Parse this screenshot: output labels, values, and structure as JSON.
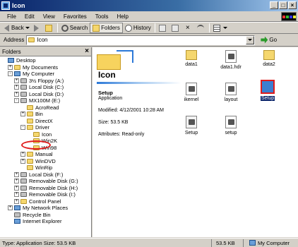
{
  "window": {
    "title": "Icon",
    "buttons": {
      "minimize": "_",
      "maximize": "□",
      "close": "×"
    }
  },
  "menubar": {
    "items": [
      "File",
      "Edit",
      "View",
      "Favorites",
      "Tools",
      "Help"
    ]
  },
  "toolbar": {
    "back_label": "Back",
    "search_label": "Search",
    "folders_label": "Folders",
    "history_label": "History"
  },
  "address": {
    "label": "Address",
    "value": "Icon",
    "go_label": "Go"
  },
  "folders_pane": {
    "header": "Folders",
    "close_glyph": "×",
    "items": [
      {
        "label": "Desktop",
        "pm": "",
        "indent": 0,
        "icon": "desktop"
      },
      {
        "label": "My Documents",
        "pm": "+",
        "indent": 1,
        "icon": "folder"
      },
      {
        "label": "My Computer",
        "pm": "-",
        "indent": 1,
        "icon": "computer"
      },
      {
        "label": "3½ Floppy (A:)",
        "pm": "+",
        "indent": 2,
        "icon": "drive"
      },
      {
        "label": "Local Disk (C:)",
        "pm": "+",
        "indent": 2,
        "icon": "drive"
      },
      {
        "label": "Local Disk (D:)",
        "pm": "+",
        "indent": 2,
        "icon": "drive"
      },
      {
        "label": "MX100M (E:)",
        "pm": "-",
        "indent": 2,
        "icon": "cdrom"
      },
      {
        "label": "AcroRead",
        "pm": "",
        "indent": 3,
        "icon": "folder"
      },
      {
        "label": "Bin",
        "pm": "+",
        "indent": 3,
        "icon": "folder"
      },
      {
        "label": "DirectX",
        "pm": "",
        "indent": 3,
        "icon": "folder"
      },
      {
        "label": "Driver",
        "pm": "-",
        "indent": 3,
        "icon": "folder"
      },
      {
        "label": "Icon",
        "pm": "",
        "indent": 4,
        "icon": "folder"
      },
      {
        "label": "Win2K",
        "pm": "",
        "indent": 4,
        "icon": "folder"
      },
      {
        "label": "Win98",
        "pm": "",
        "indent": 4,
        "icon": "folder"
      },
      {
        "label": "Manual",
        "pm": "+",
        "indent": 3,
        "icon": "folder"
      },
      {
        "label": "WinDVD",
        "pm": "+",
        "indent": 3,
        "icon": "folder"
      },
      {
        "label": "WinRip",
        "pm": "",
        "indent": 3,
        "icon": "folder"
      },
      {
        "label": "Local Disk (F:)",
        "pm": "+",
        "indent": 2,
        "icon": "drive"
      },
      {
        "label": "Removable Disk (G:)",
        "pm": "+",
        "indent": 2,
        "icon": "drive"
      },
      {
        "label": "Removable Disk (H:)",
        "pm": "+",
        "indent": 2,
        "icon": "drive"
      },
      {
        "label": "Removable Disk (I:)",
        "pm": "+",
        "indent": 2,
        "icon": "drive"
      },
      {
        "label": "Control Panel",
        "pm": "+",
        "indent": 2,
        "icon": "folder"
      },
      {
        "label": "My Network Places",
        "pm": "+",
        "indent": 1,
        "icon": "network"
      },
      {
        "label": "Recycle Bin",
        "pm": "",
        "indent": 1,
        "icon": "recycle"
      },
      {
        "label": "Internet Explorer",
        "pm": "",
        "indent": 1,
        "icon": "ie"
      }
    ]
  },
  "content": {
    "folder_title": "Icon",
    "selected_name": "Setup",
    "selected_type": "Application",
    "modified": "Modified: 4/12/2001 10:28 AM",
    "size": "Size: 53.5 KB",
    "attributes": "Attributes: Read-only",
    "files": [
      {
        "label": "data1",
        "kind": "folder"
      },
      {
        "label": "data1.hdr",
        "kind": "doc"
      },
      {
        "label": "data2",
        "kind": "folder"
      },
      {
        "label": "ikernel",
        "kind": "doc"
      },
      {
        "label": "layout",
        "kind": "doc"
      },
      {
        "label": "Setup",
        "kind": "setup-selected"
      },
      {
        "label": "Setup",
        "kind": "ini"
      },
      {
        "label": "setup",
        "kind": "doc"
      }
    ]
  },
  "statusbar": {
    "left": "Type: Application Size: 53.5 KB",
    "middle": "53.5 KB",
    "right": "My Computer"
  },
  "colors": {
    "titlebar": "#0a246a",
    "selection": "#0a246a",
    "highlight_ring": "#e01b1b"
  }
}
